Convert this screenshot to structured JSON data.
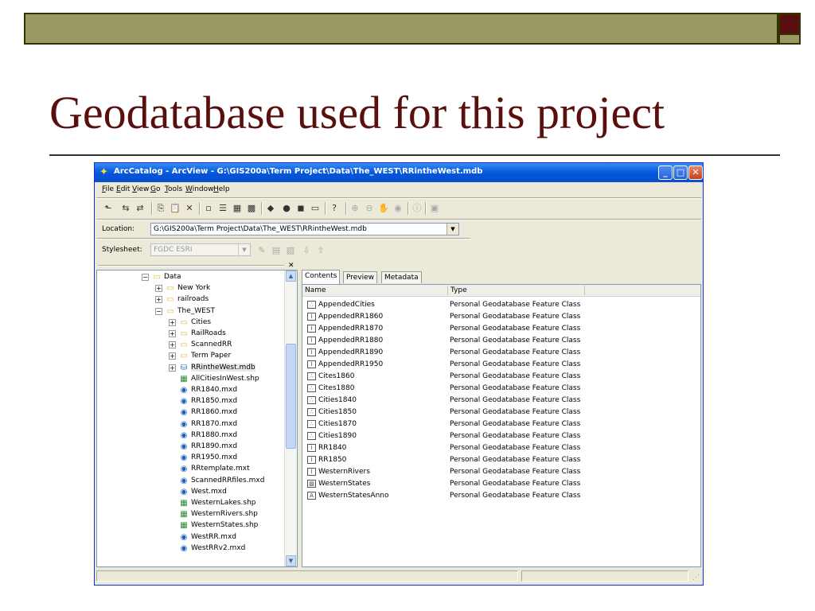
{
  "slide": {
    "title": "Geodatabase used for this project"
  },
  "window": {
    "title": "ArcCatalog - ArcView - G:\\GIS200a\\Term Project\\Data\\The_WEST\\RRintheWest.mdb",
    "minimize_label": "_",
    "maximize_label": "□",
    "close_label": "✕"
  },
  "menu": [
    {
      "label": "File",
      "u": "F",
      "rest": "ile"
    },
    {
      "label": "Edit",
      "u": "E",
      "rest": "dit"
    },
    {
      "label": "View",
      "u": "V",
      "rest": "iew"
    },
    {
      "label": "Go",
      "u": "G",
      "rest": "o"
    },
    {
      "label": "Tools",
      "u": "T",
      "rest": "ools"
    },
    {
      "label": "Window",
      "u": "W",
      "rest": "indow"
    },
    {
      "label": "Help",
      "u": "H",
      "rest": "elp"
    }
  ],
  "toolbar_icons": [
    "up-one-level-icon",
    "connect-folder-icon",
    "disconnect-folder-icon",
    "copy-icon",
    "paste-icon",
    "delete-icon",
    "large-icons-icon",
    "list-icon",
    "details-icon",
    "thumbnails-icon",
    "launch-arcmap-icon",
    "arctoolbox-icon",
    "arctoolbox-window-icon",
    "command-line-icon",
    "whats-this-icon",
    "zoom-in-icon",
    "zoom-out-icon",
    "pan-icon",
    "full-extent-icon",
    "identify-icon",
    "create-thumbnail-icon"
  ],
  "location": {
    "label": "Location:",
    "value": "G:\\GIS200a\\Term Project\\Data\\The_WEST\\RRintheWest.mdb"
  },
  "stylesheet": {
    "label": "Stylesheet:",
    "value": "FGDC ESRI"
  },
  "tree": [
    {
      "label": "Data",
      "indent": 0,
      "expander": "−",
      "icon": "folder"
    },
    {
      "label": "New York",
      "indent": 1,
      "expander": "+",
      "icon": "folder"
    },
    {
      "label": "railroads",
      "indent": 1,
      "expander": "+",
      "icon": "folder"
    },
    {
      "label": "The_WEST",
      "indent": 1,
      "expander": "−",
      "icon": "folder"
    },
    {
      "label": "Cities",
      "indent": 2,
      "expander": "+",
      "icon": "folder"
    },
    {
      "label": "RailRoads",
      "indent": 2,
      "expander": "+",
      "icon": "folder"
    },
    {
      "label": "ScannedRR",
      "indent": 2,
      "expander": "+",
      "icon": "folder"
    },
    {
      "label": "Term Paper",
      "indent": 2,
      "expander": "+",
      "icon": "folder"
    },
    {
      "label": "RRintheWest.mdb",
      "indent": 2,
      "expander": "+",
      "icon": "database",
      "selected": true
    },
    {
      "label": "AllCitiesInWest.shp",
      "indent": 2,
      "expander": "",
      "icon": "shapefile"
    },
    {
      "label": "RR1840.mxd",
      "indent": 2,
      "expander": "",
      "icon": "map"
    },
    {
      "label": "RR1850.mxd",
      "indent": 2,
      "expander": "",
      "icon": "map"
    },
    {
      "label": "RR1860.mxd",
      "indent": 2,
      "expander": "",
      "icon": "map"
    },
    {
      "label": "RR1870.mxd",
      "indent": 2,
      "expander": "",
      "icon": "map"
    },
    {
      "label": "RR1880.mxd",
      "indent": 2,
      "expander": "",
      "icon": "map"
    },
    {
      "label": "RR1890.mxd",
      "indent": 2,
      "expander": "",
      "icon": "map"
    },
    {
      "label": "RR1950.mxd",
      "indent": 2,
      "expander": "",
      "icon": "map"
    },
    {
      "label": "RRtemplate.mxt",
      "indent": 2,
      "expander": "",
      "icon": "map"
    },
    {
      "label": "ScannedRRfiles.mxd",
      "indent": 2,
      "expander": "",
      "icon": "map"
    },
    {
      "label": "West.mxd",
      "indent": 2,
      "expander": "",
      "icon": "map"
    },
    {
      "label": "WesternLakes.shp",
      "indent": 2,
      "expander": "",
      "icon": "shapefile"
    },
    {
      "label": "WesternRivers.shp",
      "indent": 2,
      "expander": "",
      "icon": "shapefile"
    },
    {
      "label": "WesternStates.shp",
      "indent": 2,
      "expander": "",
      "icon": "shapefile"
    },
    {
      "label": "WestRR.mxd",
      "indent": 2,
      "expander": "",
      "icon": "map"
    },
    {
      "label": "WestRRv2.mxd",
      "indent": 2,
      "expander": "",
      "icon": "map"
    }
  ],
  "tabs": [
    {
      "label": "Contents",
      "active": true
    },
    {
      "label": "Preview",
      "active": false
    },
    {
      "label": "Metadata",
      "active": false
    }
  ],
  "columns": {
    "name": "Name",
    "type": "Type"
  },
  "items": [
    {
      "name": "AppendedCities",
      "type": "Personal Geodatabase Feature Class",
      "icon": "point"
    },
    {
      "name": "AppendedRR1860",
      "type": "Personal Geodatabase Feature Class",
      "icon": "line"
    },
    {
      "name": "AppendedRR1870",
      "type": "Personal Geodatabase Feature Class",
      "icon": "line"
    },
    {
      "name": "AppendedRR1880",
      "type": "Personal Geodatabase Feature Class",
      "icon": "line"
    },
    {
      "name": "AppendedRR1890",
      "type": "Personal Geodatabase Feature Class",
      "icon": "line"
    },
    {
      "name": "AppendedRR1950",
      "type": "Personal Geodatabase Feature Class",
      "icon": "line"
    },
    {
      "name": "Cites1860",
      "type": "Personal Geodatabase Feature Class",
      "icon": "point"
    },
    {
      "name": "Cites1880",
      "type": "Personal Geodatabase Feature Class",
      "icon": "point"
    },
    {
      "name": "Cities1840",
      "type": "Personal Geodatabase Feature Class",
      "icon": "point"
    },
    {
      "name": "Cities1850",
      "type": "Personal Geodatabase Feature Class",
      "icon": "point"
    },
    {
      "name": "Cities1870",
      "type": "Personal Geodatabase Feature Class",
      "icon": "point"
    },
    {
      "name": "Cities1890",
      "type": "Personal Geodatabase Feature Class",
      "icon": "point"
    },
    {
      "name": "RR1840",
      "type": "Personal Geodatabase Feature Class",
      "icon": "line"
    },
    {
      "name": "RR1850",
      "type": "Personal Geodatabase Feature Class",
      "icon": "line"
    },
    {
      "name": "WesternRivers",
      "type": "Personal Geodatabase Feature Class",
      "icon": "line"
    },
    {
      "name": "WesternStates",
      "type": "Personal Geodatabase Feature Class",
      "icon": "polygon"
    },
    {
      "name": "WesternStatesAnno",
      "type": "Personal Geodatabase Feature Class",
      "icon": "annotation"
    }
  ],
  "colors": {
    "title": "#5a0f0f",
    "deco_bar": "#999966",
    "titlebar": "#0a5de0"
  }
}
